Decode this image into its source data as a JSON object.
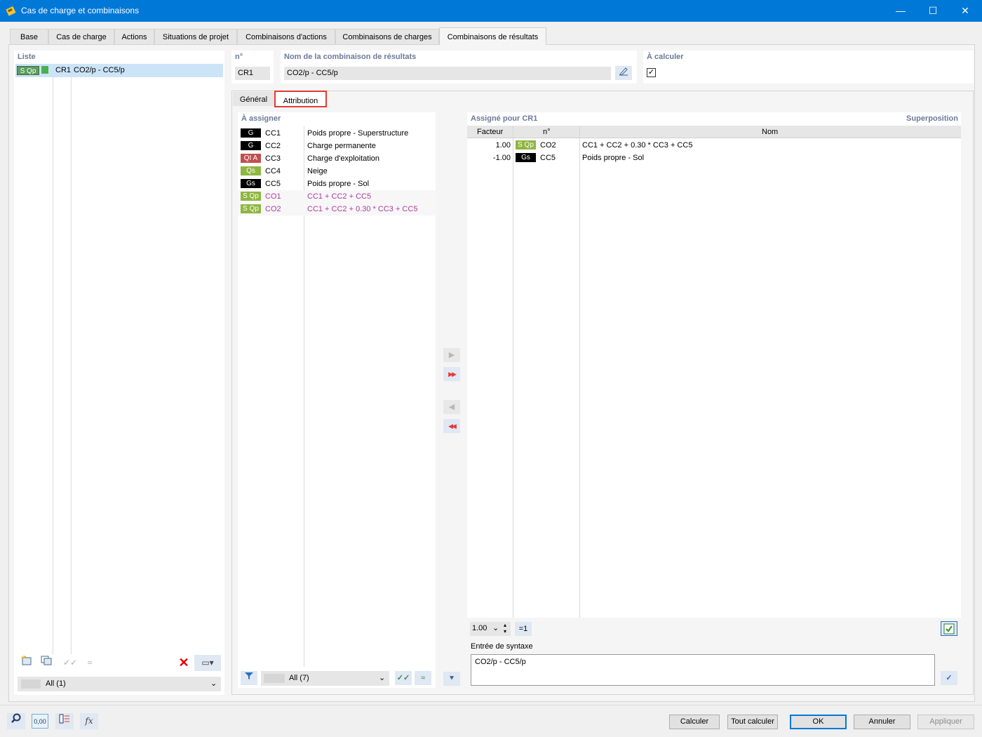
{
  "window": {
    "title": "Cas de charge et combinaisons",
    "minimize_glyph": "—",
    "maximize_glyph": "☐",
    "close_glyph": "✕"
  },
  "main_tabs": [
    "Base",
    "Cas de charge",
    "Actions",
    "Situations de projet",
    "Combinaisons d'actions",
    "Combinaisons de charges",
    "Combinaisons de résultats"
  ],
  "list_panel": {
    "header": "Liste",
    "item": {
      "badge": "S Qp",
      "id": "CR1",
      "name": "CO2/p - CC5/p"
    },
    "filter_value": "All (1)"
  },
  "number_field": {
    "label": "n°",
    "value": "CR1"
  },
  "name_field": {
    "label": "Nom de la combinaison de résultats",
    "value": "CO2/p - CC5/p"
  },
  "calc_field": {
    "label": "À calculer",
    "check": "✓"
  },
  "sub_tabs": [
    "Général",
    "Attribution"
  ],
  "to_assign": {
    "header": "À assigner",
    "rows": [
      {
        "badge": "G",
        "id": "CC1",
        "name": "Poids propre - Superstructure",
        "color": "#000000",
        "pink": false
      },
      {
        "badge": "G",
        "id": "CC2",
        "name": "Charge permanente",
        "color": "#000000",
        "pink": false
      },
      {
        "badge": "QI A",
        "id": "CC3",
        "name": "Charge d'exploitation",
        "color": "#c0504d",
        "pink": false
      },
      {
        "badge": "Qs",
        "id": "CC4",
        "name": "Neige",
        "color": "#8fb640",
        "pink": false
      },
      {
        "badge": "Gs",
        "id": "CC5",
        "name": "Poids propre - Sol",
        "color": "#000000",
        "pink": false
      },
      {
        "badge": "S Qp",
        "id": "CO1",
        "name": "CC1 + CC2 + CC5",
        "color": "#8fb640",
        "pink": true
      },
      {
        "badge": "S Qp",
        "id": "CO2",
        "name": "CC1 + CC2 + 0.30 * CC3 + CC5",
        "color": "#8fb640",
        "pink": true
      }
    ],
    "filter_value": "All (7)"
  },
  "transfer_buttons": {
    "add_one": "▶",
    "add_all": "▶▶",
    "remove_one": "◀",
    "remove_all": "◀◀",
    "move_down": "⯆"
  },
  "assigned": {
    "header": "Assigné pour CR1",
    "mode": "Superposition",
    "columns": [
      "Facteur",
      "n°",
      "Nom"
    ],
    "rows": [
      {
        "factor": "1.00",
        "badge": "S Qp",
        "id": "CO2",
        "name": "CC1 + CC2 + 0.30 * CC3 + CC5",
        "color": "#8fb640"
      },
      {
        "factor": "-1.00",
        "badge": "Gs",
        "id": "CC5",
        "name": "Poids propre - Sol",
        "color": "#000000"
      }
    ],
    "factor_select": "1.00",
    "eq_one_button": "=1"
  },
  "syntax": {
    "label": "Entrée de syntaxe",
    "value": "CO2/p - CC5/p"
  },
  "footer_buttons": {
    "calculer": "Calculer",
    "tout_calculer": "Tout calculer",
    "ok": "OK",
    "annuler": "Annuler",
    "appliquer": "Appliquer"
  },
  "footer_icons": {
    "units_value": "0,00",
    "formula_label": "fx"
  },
  "colors": {
    "accent": "#0078d7",
    "header_text": "#6b7a99",
    "selection": "#cce4f7",
    "highlight_border": "#e53935"
  }
}
